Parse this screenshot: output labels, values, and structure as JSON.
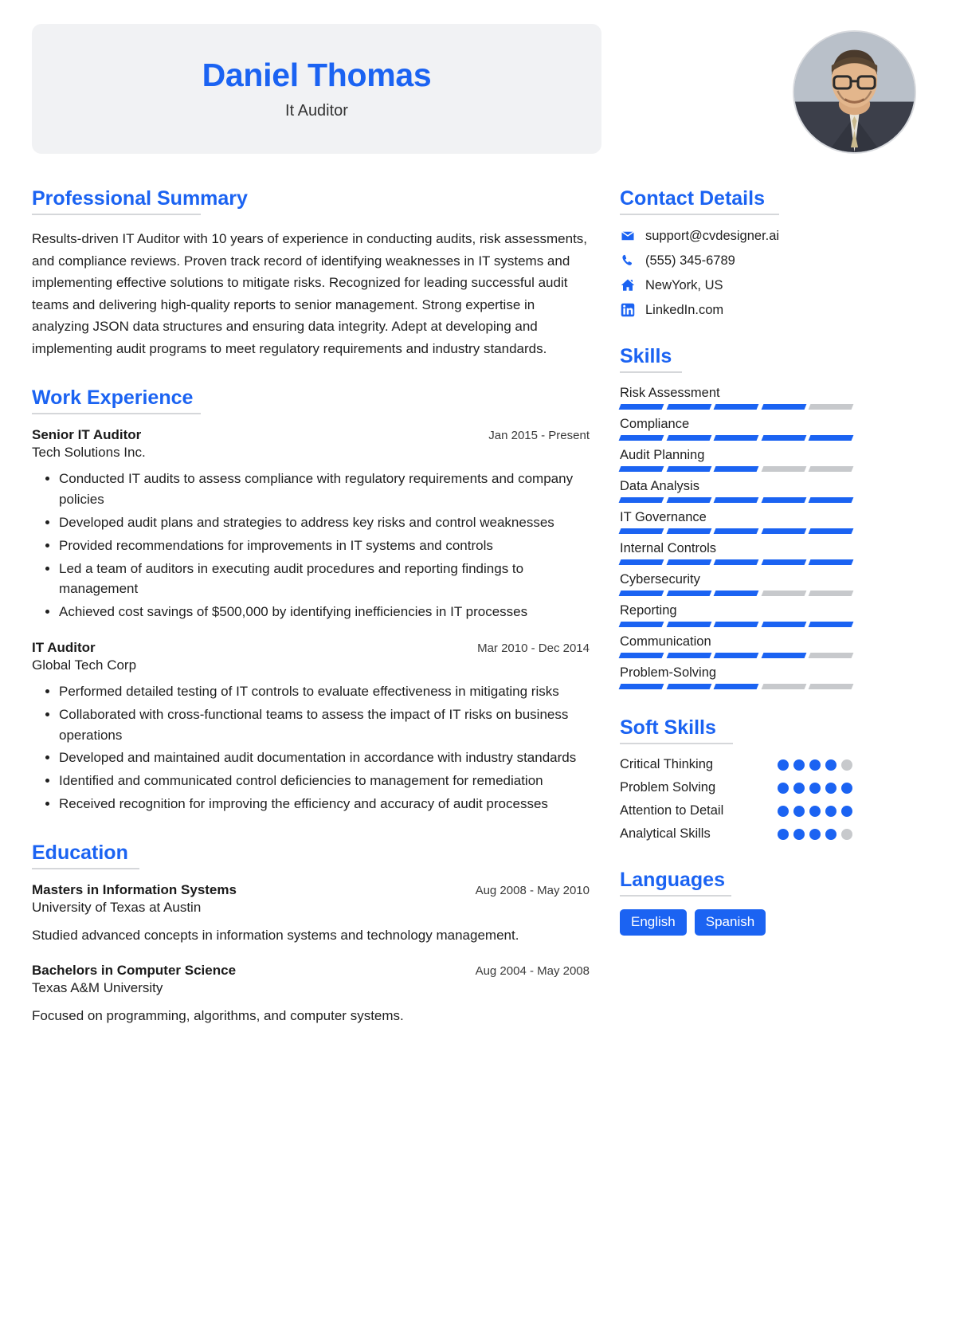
{
  "header": {
    "full_name": "Daniel Thomas",
    "job_title": "It Auditor",
    "avatar_alt": "profile-photo"
  },
  "colors": {
    "accent": "#1b63f2",
    "band": "#f1f2f4",
    "rule": "#d5d7da",
    "segment_off": "#c7c9cc",
    "text": "#1f1f1f"
  },
  "summary": {
    "heading": "Professional Summary",
    "text": "Results-driven IT Auditor with 10 years of experience in conducting audits, risk assessments, and compliance reviews. Proven track record of identifying weaknesses in IT systems and implementing effective solutions to mitigate risks. Recognized for leading successful audit teams and delivering high-quality reports to senior management. Strong expertise in analyzing JSON data structures and ensuring data integrity. Adept at developing and implementing audit programs to meet regulatory requirements and industry standards."
  },
  "work": {
    "heading": "Work Experience",
    "entries": [
      {
        "role": "Senior IT Auditor",
        "date": "Jan 2015 - Present",
        "org": "Tech Solutions Inc.",
        "bullets": [
          "Conducted IT audits to assess compliance with regulatory requirements and company policies",
          "Developed audit plans and strategies to address key risks and control weaknesses",
          "Provided recommendations for improvements in IT systems and controls",
          "Led a team of auditors in executing audit procedures and reporting findings to management",
          "Achieved cost savings of $500,000 by identifying inefficiencies in IT processes"
        ]
      },
      {
        "role": "IT Auditor",
        "date": "Mar 2010 - Dec 2014",
        "org": "Global Tech Corp",
        "bullets": [
          "Performed detailed testing of IT controls to evaluate effectiveness in mitigating risks",
          "Collaborated with cross-functional teams to assess the impact of IT risks on business operations",
          "Developed and maintained audit documentation in accordance with industry standards",
          "Identified and communicated control deficiencies to management for remediation",
          "Received recognition for improving the efficiency and accuracy of audit processes"
        ]
      }
    ]
  },
  "education": {
    "heading": "Education",
    "entries": [
      {
        "degree": "Masters in Information Systems",
        "date": "Aug 2008 - May 2010",
        "school": "University of Texas at Austin",
        "description": "Studied advanced concepts in information systems and technology management."
      },
      {
        "degree": "Bachelors in Computer Science",
        "date": "Aug 2004 - May 2008",
        "school": "Texas A&M University",
        "description": "Focused on programming, algorithms, and computer systems."
      }
    ]
  },
  "contact": {
    "heading": "Contact Details",
    "items": [
      {
        "icon": "envelope-icon",
        "value": "support@cvdesigner.ai"
      },
      {
        "icon": "phone-icon",
        "value": "(555) 345-6789"
      },
      {
        "icon": "home-icon",
        "value": "NewYork, US"
      },
      {
        "icon": "linkedin-icon",
        "value": "LinkedIn.com"
      }
    ]
  },
  "skills": {
    "heading": "Skills",
    "segments_total": 5,
    "items": [
      {
        "name": "Risk Assessment",
        "filled": 4
      },
      {
        "name": "Compliance",
        "filled": 5
      },
      {
        "name": "Audit Planning",
        "filled": 3
      },
      {
        "name": "Data Analysis",
        "filled": 5
      },
      {
        "name": "IT Governance",
        "filled": 5
      },
      {
        "name": "Internal Controls",
        "filled": 5
      },
      {
        "name": "Cybersecurity",
        "filled": 3
      },
      {
        "name": "Reporting",
        "filled": 5
      },
      {
        "name": "Communication",
        "filled": 4
      },
      {
        "name": "Problem-Solving",
        "filled": 3
      }
    ]
  },
  "soft_skills": {
    "heading": "Soft Skills",
    "dots_total": 5,
    "items": [
      {
        "name": "Critical Thinking",
        "filled": 4
      },
      {
        "name": "Problem Solving",
        "filled": 5
      },
      {
        "name": "Attention to Detail",
        "filled": 5
      },
      {
        "name": "Analytical Skills",
        "filled": 4
      }
    ]
  },
  "languages": {
    "heading": "Languages",
    "items": [
      "English",
      "Spanish"
    ]
  }
}
